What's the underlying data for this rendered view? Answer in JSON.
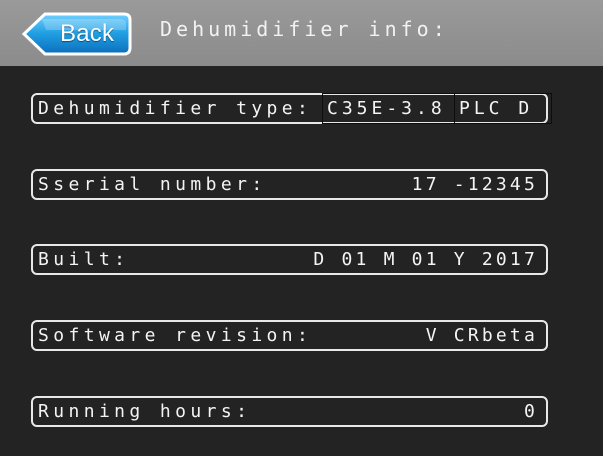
{
  "header": {
    "back_label": "Back",
    "title": "Dehumidifier info:"
  },
  "fields": {
    "type": {
      "label": "Dehumidifier type:",
      "value_code": "C35E-3.8",
      "value_plc": "PLC D"
    },
    "serial": {
      "label": "Sserial number:",
      "value": "17 -12345"
    },
    "built": {
      "label": "Built:",
      "value": "D 01 M 01 Y 2017"
    },
    "software": {
      "label": "Software revision:",
      "value": "V CRbeta"
    },
    "hours": {
      "label": "Running hours:",
      "value": "0"
    }
  },
  "colors": {
    "background": "#232323",
    "header": "#8f8f8f",
    "back_button": "#1e9bdc",
    "text": "#f4f4f4",
    "field_border": "#e8e8e8"
  },
  "icons": {
    "back": "back-arrow-button-icon"
  }
}
